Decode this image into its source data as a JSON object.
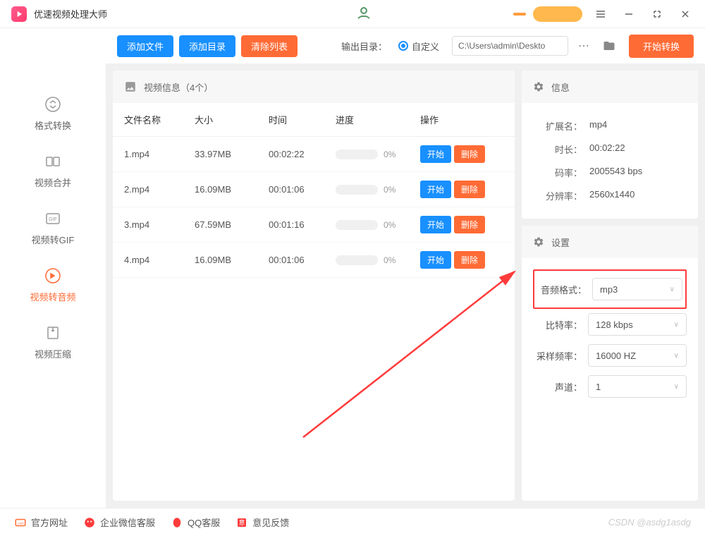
{
  "app": {
    "title": "优速视频处理大师"
  },
  "toolbar": {
    "add_file": "添加文件",
    "add_dir": "添加目录",
    "clear_list": "清除列表",
    "output_label": "输出目录：",
    "output_custom": "自定义",
    "output_path": "C:\\Users\\admin\\Deskto",
    "start_convert": "开始转换"
  },
  "sidebar": {
    "items": [
      {
        "label": "格式转换",
        "icon": "swap"
      },
      {
        "label": "视频合并",
        "icon": "merge"
      },
      {
        "label": "视频转GIF",
        "icon": "gif"
      },
      {
        "label": "视频转音频",
        "icon": "audio"
      },
      {
        "label": "视频压缩",
        "icon": "compress"
      }
    ]
  },
  "file_panel": {
    "header": "视频信息（4个）",
    "columns": {
      "name": "文件名称",
      "size": "大小",
      "time": "时间",
      "progress": "进度",
      "action": "操作"
    },
    "rows": [
      {
        "name": "1.mp4",
        "size": "33.97MB",
        "time": "00:02:22",
        "progress": "0%"
      },
      {
        "name": "2.mp4",
        "size": "16.09MB",
        "time": "00:01:06",
        "progress": "0%"
      },
      {
        "name": "3.mp4",
        "size": "67.59MB",
        "time": "00:01:16",
        "progress": "0%"
      },
      {
        "name": "4.mp4",
        "size": "16.09MB",
        "time": "00:01:06",
        "progress": "0%"
      }
    ],
    "btn_start": "开始",
    "btn_delete": "删除"
  },
  "info": {
    "header": "信息",
    "ext_label": "扩展名：",
    "ext_value": "mp4",
    "duration_label": "时长：",
    "duration_value": "00:02:22",
    "bitrate_label": "码率：",
    "bitrate_value": "2005543 bps",
    "resolution_label": "分辨率：",
    "resolution_value": "2560x1440"
  },
  "settings": {
    "header": "设置",
    "audio_format_label": "音频格式：",
    "audio_format_value": "mp3",
    "bitrate_label": "比特率：",
    "bitrate_value": "128 kbps",
    "samplerate_label": "采样频率：",
    "samplerate_value": "16000 HZ",
    "channel_label": "声道：",
    "channel_value": "1"
  },
  "footer": {
    "official": "官方网址",
    "wechat": "企业微信客服",
    "qq": "QQ客服",
    "feedback": "意见反馈",
    "watermark": "CSDN @asdg1asdg"
  }
}
